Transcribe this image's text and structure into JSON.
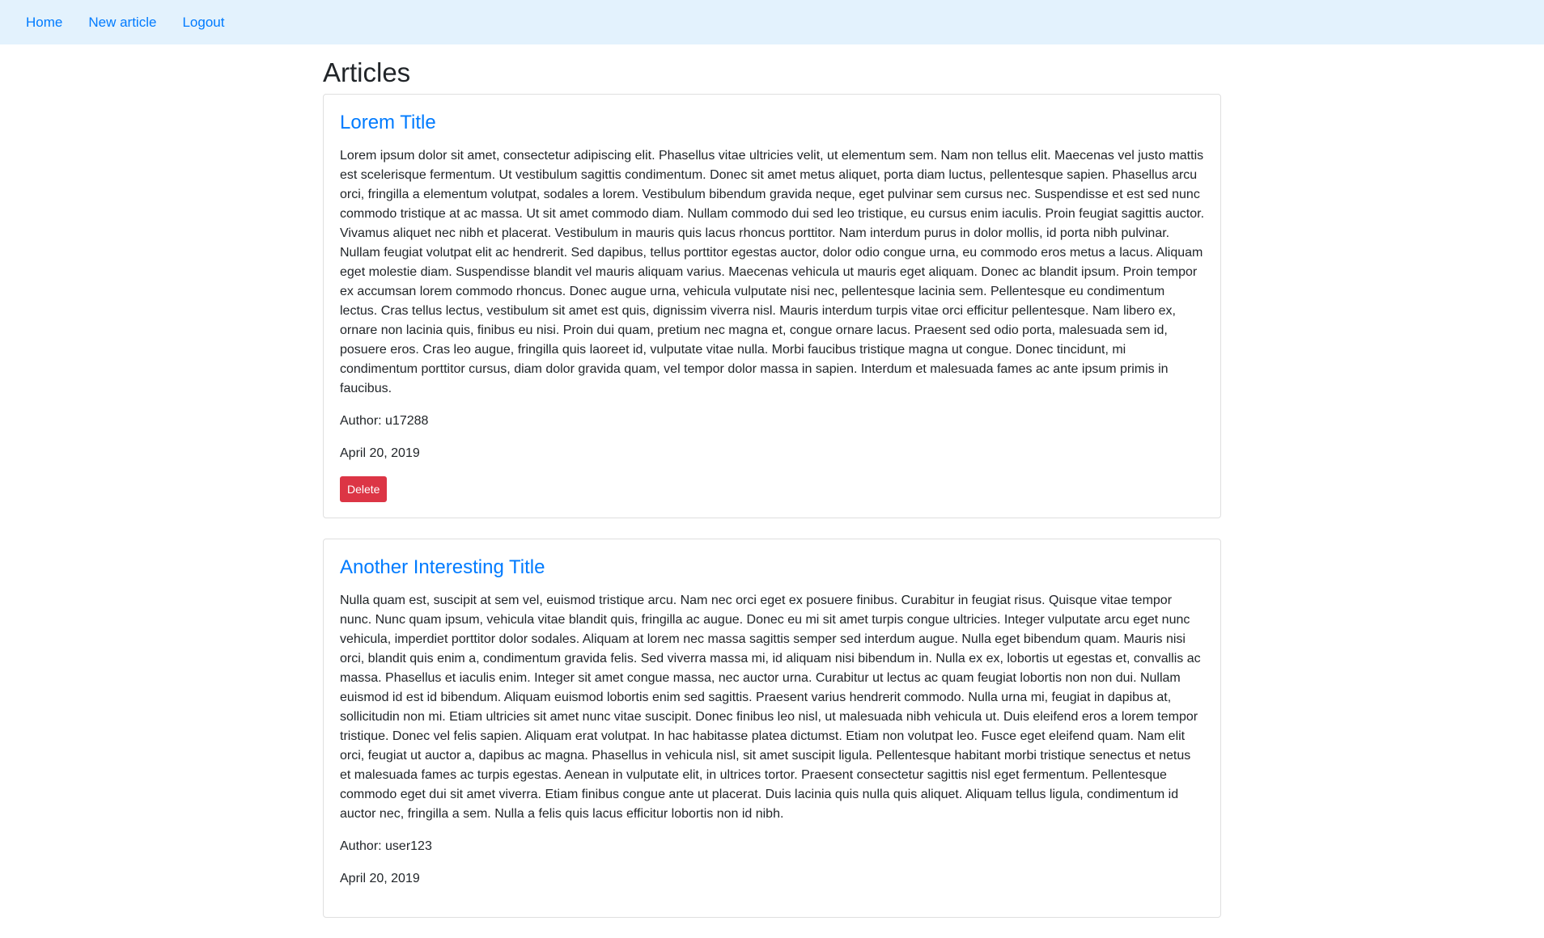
{
  "nav": {
    "home": "Home",
    "new_article": "New article",
    "logout": "Logout"
  },
  "colors": {
    "navbar_bg": "#e3f2fd",
    "link": "#007bff",
    "danger": "#dc3545"
  },
  "page": {
    "title": "Articles"
  },
  "articles": [
    {
      "title": "Lorem Title",
      "body": "Lorem ipsum dolor sit amet, consectetur adipiscing elit. Phasellus vitae ultricies velit, ut elementum sem. Nam non tellus elit. Maecenas vel justo mattis est scelerisque fermentum. Ut vestibulum sagittis condimentum. Donec sit amet metus aliquet, porta diam luctus, pellentesque sapien. Phasellus arcu orci, fringilla a elementum volutpat, sodales a lorem. Vestibulum bibendum gravida neque, eget pulvinar sem cursus nec. Suspendisse et est sed nunc commodo tristique at ac massa. Ut sit amet commodo diam. Nullam commodo dui sed leo tristique, eu cursus enim iaculis. Proin feugiat sagittis auctor. Vivamus aliquet nec nibh et placerat. Vestibulum in mauris quis lacus rhoncus porttitor. Nam interdum purus in dolor mollis, id porta nibh pulvinar. Nullam feugiat volutpat elit ac hendrerit. Sed dapibus, tellus porttitor egestas auctor, dolor odio congue urna, eu commodo eros metus a lacus. Aliquam eget molestie diam. Suspendisse blandit vel mauris aliquam varius. Maecenas vehicula ut mauris eget aliquam. Donec ac blandit ipsum. Proin tempor ex accumsan lorem commodo rhoncus. Donec augue urna, vehicula vulputate nisi nec, pellentesque lacinia sem. Pellentesque eu condimentum lectus. Cras tellus lectus, vestibulum sit amet est quis, dignissim viverra nisl. Mauris interdum turpis vitae orci efficitur pellentesque. Nam libero ex, ornare non lacinia quis, finibus eu nisi. Proin dui quam, pretium nec magna et, congue ornare lacus. Praesent sed odio porta, malesuada sem id, posuere eros. Cras leo augue, fringilla quis laoreet id, vulputate vitae nulla. Morbi faucibus tristique magna ut congue. Donec tincidunt, mi condimentum porttitor cursus, diam dolor gravida quam, vel tempor dolor massa in sapien. Interdum et malesuada fames ac ante ipsum primis in faucibus.",
      "author": "Author: u17288",
      "date": "April 20, 2019",
      "delete_label": "Delete"
    },
    {
      "title": "Another Interesting Title",
      "body": "Nulla quam est, suscipit at sem vel, euismod tristique arcu. Nam nec orci eget ex posuere finibus. Curabitur in feugiat risus. Quisque vitae tempor nunc. Nunc quam ipsum, vehicula vitae blandit quis, fringilla ac augue. Donec eu mi sit amet turpis congue ultricies. Integer vulputate arcu eget nunc vehicula, imperdiet porttitor dolor sodales. Aliquam at lorem nec massa sagittis semper sed interdum augue. Nulla eget bibendum quam. Mauris nisi orci, blandit quis enim a, condimentum gravida felis. Sed viverra massa mi, id aliquam nisi bibendum in. Nulla ex ex, lobortis ut egestas et, convallis ac massa. Phasellus et iaculis enim. Integer sit amet congue massa, nec auctor urna. Curabitur ut lectus ac quam feugiat lobortis non non dui. Nullam euismod id est id bibendum. Aliquam euismod lobortis enim sed sagittis. Praesent varius hendrerit commodo. Nulla urna mi, feugiat in dapibus at, sollicitudin non mi. Etiam ultricies sit amet nunc vitae suscipit. Donec finibus leo nisl, ut malesuada nibh vehicula ut. Duis eleifend eros a lorem tempor tristique. Donec vel felis sapien. Aliquam erat volutpat. In hac habitasse platea dictumst. Etiam non volutpat leo. Fusce eget eleifend quam. Nam elit orci, feugiat ut auctor a, dapibus ac magna. Phasellus in vehicula nisl, sit amet suscipit ligula. Pellentesque habitant morbi tristique senectus et netus et malesuada fames ac turpis egestas. Aenean in vulputate elit, in ultrices tortor. Praesent consectetur sagittis nisl eget fermentum. Pellentesque commodo eget dui sit amet viverra. Etiam finibus congue ante ut placerat. Duis lacinia quis nulla quis aliquet. Aliquam tellus ligula, condimentum id auctor nec, fringilla a sem. Nulla a felis quis lacus efficitur lobortis non id nibh.",
      "author": "Author: user123",
      "date": "April 20, 2019"
    }
  ]
}
